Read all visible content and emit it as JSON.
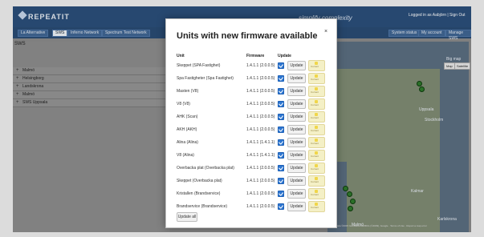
{
  "app": {
    "logo": "REPEATIT",
    "slogan": "simplify complexity",
    "user_label": "Logged in as Aabjörn | Sign Out"
  },
  "tabs": [
    {
      "label": "La Alternative"
    },
    {
      "label": "SWS"
    },
    {
      "label": "Inferno Network"
    },
    {
      "label": "Spectrum Test Network"
    }
  ],
  "toolbar": {
    "system_status": "System status",
    "my_account": "My account",
    "manage_sws": "Manage SWS"
  },
  "left": {
    "title": "SWS",
    "tree": [
      "Malmö",
      "Helsingborg",
      "Landskrona",
      "Malmö",
      "SWS Uppsala"
    ]
  },
  "map": {
    "label": "Big map",
    "btn_map": "Map",
    "btn_sat": "Satellite",
    "labels": [
      "Uppsala",
      "Stockholm",
      "Kalmar",
      "Karlskrona",
      "Malmö"
    ],
    "footer": "Map data ©2015 GeoBasis-DE/BKG (©2009), Google · Terms of Use · Report a map error"
  },
  "modal": {
    "title": "Units with new firmware available",
    "close": "×",
    "columns": {
      "unit": "Unit",
      "firmware": "Firmware",
      "update": "Update"
    },
    "rows": [
      {
        "unit": "Skeppet (SPA Fastighet)",
        "firmware": "1.4.1.1 (2.0.0.5)",
        "button": "Update",
        "tag": "Current"
      },
      {
        "unit": "Spa Fastigheter (Spa Fastighet)",
        "firmware": "1.4.1.1 (2.0.0.5)",
        "button": "Update",
        "tag": "Current"
      },
      {
        "unit": "Masten (V8)",
        "firmware": "1.4.1.1 (2.0.0.5)",
        "button": "Update",
        "tag": "Current"
      },
      {
        "unit": "V8 (V8)",
        "firmware": "1.4.1.1 (2.0.0.5)",
        "button": "Update",
        "tag": "Current"
      },
      {
        "unit": "AHK (Scan)",
        "firmware": "1.4.1.1 (2.0.0.5)",
        "button": "Update",
        "tag": "Current"
      },
      {
        "unit": "AKH (AKH)",
        "firmware": "1.4.1.1 (2.0.0.5)",
        "button": "Update",
        "tag": "Current"
      },
      {
        "unit": "Alina (Alina)",
        "firmware": "1.4.1.1 (1.4.1.1)",
        "button": "Update",
        "tag": "Current"
      },
      {
        "unit": "V8 (Alina)",
        "firmware": "1.4.1.1 (1.4.1.1)",
        "button": "Update",
        "tag": "Current"
      },
      {
        "unit": "Overbacka plat (Overbacka plat)",
        "firmware": "1.4.1.1 (2.0.0.5)",
        "button": "Update",
        "tag": "Current"
      },
      {
        "unit": "Skeppet (Overbacka plat)",
        "firmware": "1.4.1.1 (2.0.0.5)",
        "button": "Update",
        "tag": "Current"
      },
      {
        "unit": "Kristallen (Brandservice)",
        "firmware": "1.4.1.1 (2.0.0.5)",
        "button": "Update",
        "tag": "Current"
      },
      {
        "unit": "Brandservice (Brandservice)",
        "firmware": "1.4.1.1 (2.0.0.5)",
        "button": "Update",
        "tag": "Current"
      }
    ],
    "update_all": "Update all"
  }
}
